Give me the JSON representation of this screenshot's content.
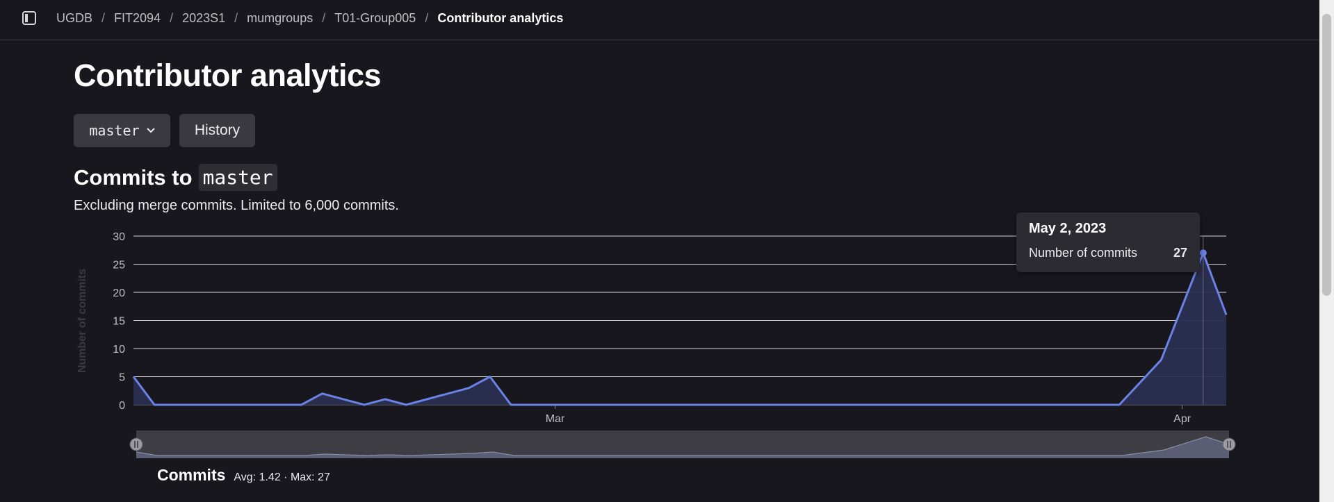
{
  "breadcrumb": {
    "items": [
      "UGDB",
      "FIT2094",
      "2023S1",
      "mumgroups",
      "T01-Group005"
    ],
    "current": "Contributor analytics",
    "separator": "/"
  },
  "page": {
    "title": "Contributor analytics",
    "branch_label": "master",
    "history_label": "History",
    "section_prefix": "Commits to",
    "section_branch": "master",
    "subtitle": "Excluding merge commits. Limited to 6,000 commits."
  },
  "tooltip": {
    "date": "May 2, 2023",
    "label": "Number of commits",
    "value": "27"
  },
  "footer": {
    "label": "Commits",
    "stats": "Avg: 1.42 · Max: 27"
  },
  "colors": {
    "accent": "#6b83e6",
    "fill": "#2a2f52",
    "background": "#18171d",
    "grid": "#d6d6d9"
  },
  "chart_data": {
    "type": "area",
    "ylabel": "Number of commits",
    "ylim": [
      0,
      30
    ],
    "yticks": [
      0,
      5,
      10,
      15,
      20,
      25,
      30
    ],
    "xlabels": [
      {
        "label": "Mar",
        "x": 20.1
      },
      {
        "label": "Apr",
        "x": 50.0
      }
    ],
    "xlim": [
      0,
      52.1
    ],
    "grid": true,
    "series": [
      {
        "name": "",
        "points": [
          [
            0,
            5
          ],
          [
            1,
            0
          ],
          [
            8,
            0
          ],
          [
            9,
            2
          ],
          [
            11,
            0
          ],
          [
            12,
            1
          ],
          [
            13,
            0
          ],
          [
            16,
            3
          ],
          [
            17,
            5
          ],
          [
            18,
            0
          ],
          [
            47,
            0
          ],
          [
            49,
            8
          ],
          [
            51,
            27
          ],
          [
            52.1,
            16
          ]
        ]
      }
    ]
  }
}
